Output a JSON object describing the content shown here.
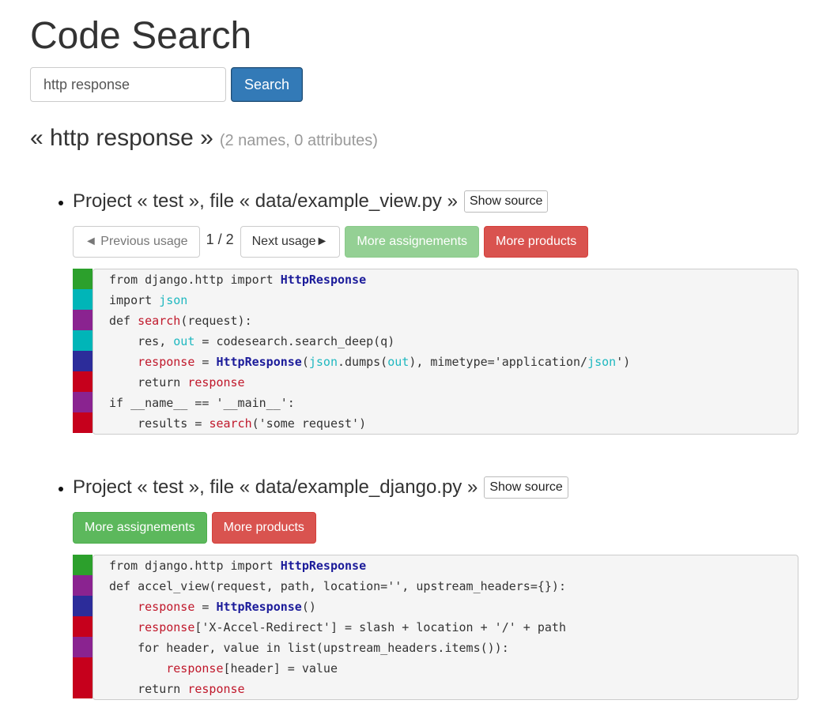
{
  "page": {
    "title": "Code Search"
  },
  "search": {
    "query": "http response",
    "button_label": "Search"
  },
  "results": {
    "query_display": "« http response »",
    "summary": "(2 names, 0 attributes)"
  },
  "colors": {
    "green": "#2ca02c",
    "cyan": "#00b5b8",
    "purple": "#8a2390",
    "navy": "#2c2c9a",
    "red": "#c6001c"
  },
  "items": [
    {
      "file_title": "Project « test », file « data/example_view.py »",
      "show_source": "Show source",
      "prev_label": "◄ Previous usage",
      "pager": "1 / 2",
      "next_label": "Next usage►",
      "assign_label": "More assignements",
      "products_label": "More products",
      "gutter": [
        "green",
        "cyan",
        "purple",
        "cyan",
        "navy",
        "red",
        "purple",
        "red"
      ],
      "lines": [
        [
          [
            "kw",
            "from django.http import "
          ],
          [
            "cls",
            "HttpResponse"
          ]
        ],
        [
          [
            "kw",
            "import "
          ],
          [
            "cyan",
            "json"
          ]
        ],
        [
          [
            "kw",
            "def "
          ],
          [
            "red",
            "search"
          ],
          [
            "kw",
            "(request):"
          ]
        ],
        [
          [
            "kw",
            "    res, "
          ],
          [
            "cyan",
            "out"
          ],
          [
            "kw",
            " = codesearch.search_deep(q)"
          ]
        ],
        [
          [
            "kw",
            "    "
          ],
          [
            "red",
            "response"
          ],
          [
            "kw",
            " = "
          ],
          [
            "cls",
            "HttpResponse"
          ],
          [
            "kw",
            "("
          ],
          [
            "cyan",
            "json"
          ],
          [
            "kw",
            ".dumps("
          ],
          [
            "cyan",
            "out"
          ],
          [
            "kw",
            "), mimetype='application/"
          ],
          [
            "cyan",
            "json"
          ],
          [
            "kw",
            "')"
          ]
        ],
        [
          [
            "kw",
            "    return "
          ],
          [
            "red",
            "response"
          ]
        ],
        [
          [
            "kw",
            "if __name__ == '__main__':"
          ]
        ],
        [
          [
            "kw",
            "    results = "
          ],
          [
            "red",
            "search"
          ],
          [
            "kw",
            "('some request')"
          ]
        ]
      ]
    },
    {
      "file_title": "Project « test », file « data/example_django.py »",
      "show_source": "Show source",
      "assign_label": "More assignements",
      "products_label": "More products",
      "gutter": [
        "green",
        "purple",
        "navy",
        "red",
        "purple",
        "red",
        "red"
      ],
      "lines": [
        [
          [
            "kw",
            "from django.http import "
          ],
          [
            "cls",
            "HttpResponse"
          ]
        ],
        [
          [
            "kw",
            "def accel_view(request, path, location='', upstream_headers={}):"
          ]
        ],
        [
          [
            "kw",
            "    "
          ],
          [
            "red",
            "response"
          ],
          [
            "kw",
            " = "
          ],
          [
            "cls",
            "HttpResponse"
          ],
          [
            "kw",
            "()"
          ]
        ],
        [
          [
            "kw",
            "    "
          ],
          [
            "red",
            "response"
          ],
          [
            "kw",
            "['X-Accel-Redirect'] = slash + location + '/' + path"
          ]
        ],
        [
          [
            "kw",
            "    for header, value in list(upstream_headers.items()):"
          ]
        ],
        [
          [
            "kw",
            "        "
          ],
          [
            "red",
            "response"
          ],
          [
            "kw",
            "[header] = value"
          ]
        ],
        [
          [
            "kw",
            "    return "
          ],
          [
            "red",
            "response"
          ]
        ]
      ]
    }
  ]
}
